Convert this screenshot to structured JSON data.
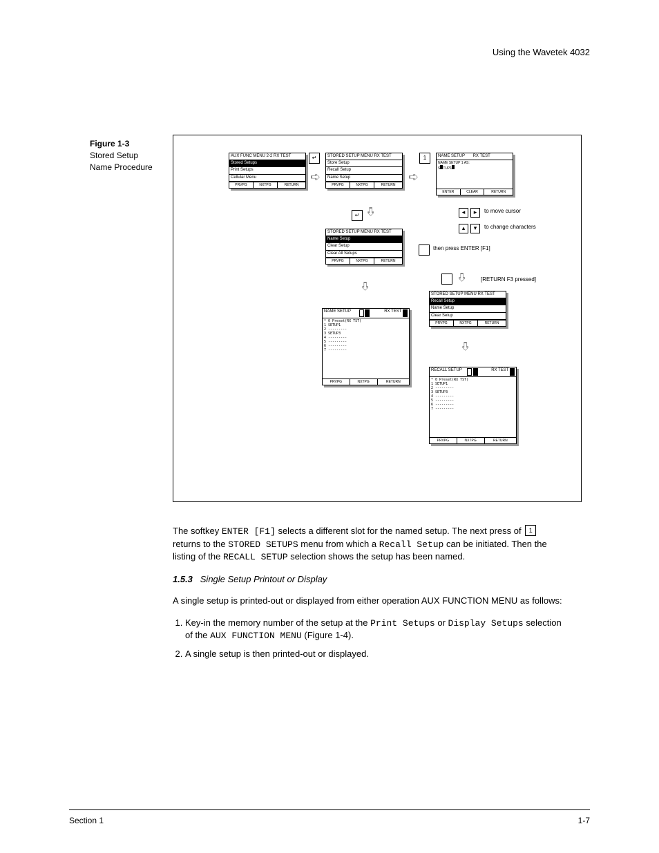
{
  "header": "Using the Wavetek 4032",
  "figure": {
    "number": "Figure 1-3",
    "caption": "Stored Setup Name Procedure"
  },
  "screens": {
    "topA": {
      "line1": "AUX FUNC MENU   2-2   RX TEST",
      "highlight": "Stored Setups",
      "line3": "Print Setups",
      "line4": "Cellular Menu",
      "k1": "PRVPG",
      "k2": "NXTPG",
      "k3": "RETURN"
    },
    "topB": {
      "line1": "STORED SETUP MENU   RX TEST",
      "line2": "Store Setup",
      "line3": "Recall Setup",
      "line4": "Name Setup",
      "k1": "PRVPG",
      "k2": "NXTPG",
      "k3": "RETURN"
    },
    "topC": {
      "title_left": "NAME SETUP",
      "title_right": "RX TEST",
      "prompt1": "NAME SETUP   1 AS:",
      "prompt2": "S  TUP1_",
      "k1": "ENTER",
      "k2": "CLEAR",
      "k3": "RETURN"
    },
    "midB": {
      "line1": "STORED SETUP MENU   RX TEST",
      "highlight": "Name Setup",
      "line3": "Clear Setup",
      "line4": "Clear All Setups",
      "k1": "PRVPG",
      "k2": "NXTPG",
      "k3": "RETURN"
    },
    "bigA": {
      "title": "NAME SETUP",
      "mode": "RX TEST",
      "rows": [
        "*   0  Preset(RX TST)",
        "    1  SETUP1",
        "    2  ---------",
        "    3  SETUP3",
        "    4  ---------",
        "    5  ---------",
        "    6  ---------",
        "    7  ---------"
      ],
      "k1": "PRVPG",
      "k2": "NXTPG",
      "k3": "RETURN"
    },
    "midC": {
      "line1": "STORED SETUP MENU   RX TEST",
      "highlight": "Recall Setup",
      "line3": "Name Setup",
      "line4": "Clear Setup",
      "k1": "PRVPG",
      "k2": "NXTPG",
      "k3": "RETURN"
    },
    "bigB": {
      "title": "RECALL SETUP",
      "mode": "RX TEST",
      "rows": [
        "*   0  Preset(RX TST)",
        "    1  SETUP1",
        "    2  ---------",
        "    3  SETUP3",
        "    4  ---------",
        "    5  ---------",
        "    6  ---------",
        "    7  ---------"
      ],
      "k1": "PRVPG",
      "k2": "NXTPG",
      "k3": "RETURN"
    }
  },
  "keys": {
    "enter": "↵",
    "one": "1"
  },
  "annots": {
    "move_cursor": "to move cursor",
    "change_chars": "to change characters",
    "enter_press": "then press ENTER [F1]",
    "return_note": "[RETURN  F3 pressed]"
  },
  "body": {
    "p1a": "The softkey ",
    "p1b": " selects a different slot for the named setup. The next press of ",
    "p1c": " returns to the ",
    "p1d": " menu from which a ",
    "p1e": " can be initiated. Then the listing of the ",
    "p1f": " selection shows the setup has been named.",
    "enter_label": "ENTER [F1]",
    "one_label": "1",
    "stored_setups": "STORED SETUPS",
    "recall_setup_code": "Recall Setup",
    "recall_setup_txt": "RECALL SETUP",
    "sec_num": "1.5.3",
    "sec_title": "Single Setup Printout or Display",
    "p2": "A single setup is printed-out or displayed from either operation AUX FUNCTION MENU as follows:",
    "li1a": "Key-in the memory number of the setup at the ",
    "li1b": " or ",
    "li1c": " selection of the ",
    "li1d": " (",
    "li1e": ").",
    "print_setups": "Print Setups",
    "display_setups": "Display Setups",
    "aux_menu": "AUX FUNCTION MENU",
    "fig_ref": "Figure 1-4",
    "li2": "A single setup is then printed-out or displayed."
  },
  "footer": {
    "left": "Section 1",
    "right": "1-7"
  }
}
